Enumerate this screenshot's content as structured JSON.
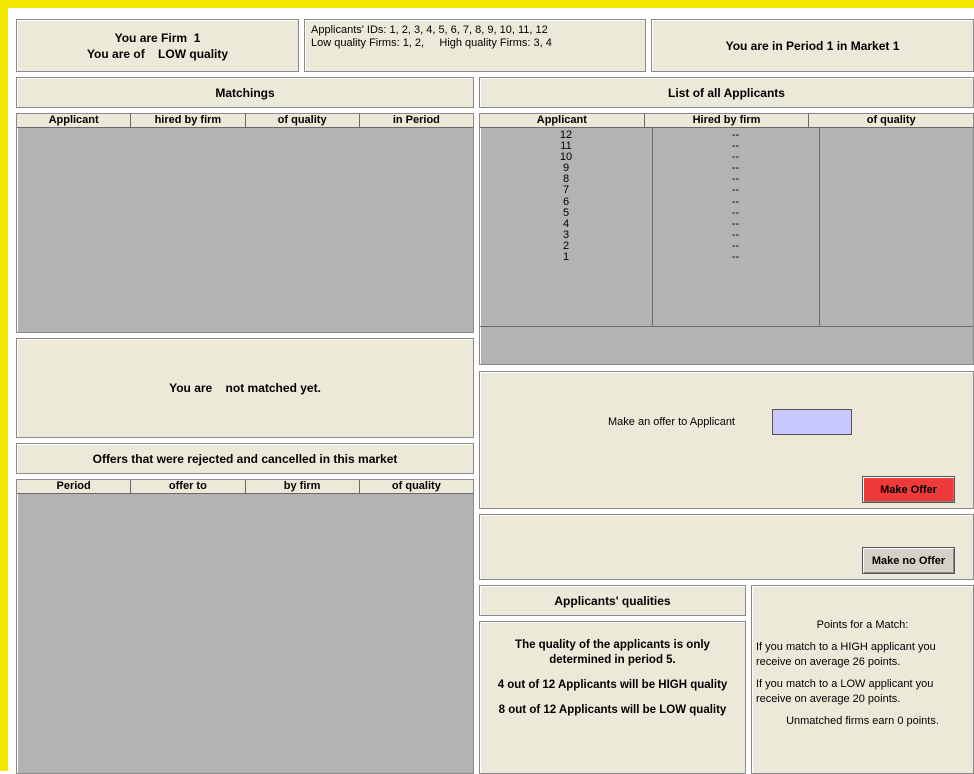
{
  "header": {
    "firm_line": "You are Firm  1",
    "quality_line": "You are of    LOW quality",
    "ids_line": "Applicants' IDs: 1, 2, 3, 4, 5, 6, 7, 8, 9, 10, 11, 12",
    "firms_line": "Low quality Firms: 1, 2,     High quality Firms: 3, 4",
    "period_line": "You are in Period 1 in Market 1"
  },
  "matchings": {
    "title": "Matchings",
    "columns": [
      "Applicant",
      "hired by firm",
      "of quality",
      "in Period"
    ]
  },
  "match_status": "You are    not matched yet.",
  "offers": {
    "title": "Offers that were rejected and cancelled in this market",
    "columns": [
      "Period",
      "offer to",
      "by firm",
      "of quality"
    ]
  },
  "applicants": {
    "title": "List of all Applicants",
    "columns": [
      "Applicant",
      "Hired by firm",
      "of quality"
    ],
    "rows": [
      {
        "id": "12",
        "hired": "--"
      },
      {
        "id": "11",
        "hired": "--"
      },
      {
        "id": "10",
        "hired": "--"
      },
      {
        "id": "9",
        "hired": "--"
      },
      {
        "id": "8",
        "hired": "--"
      },
      {
        "id": "7",
        "hired": "--"
      },
      {
        "id": "6",
        "hired": "--"
      },
      {
        "id": "5",
        "hired": "--"
      },
      {
        "id": "4",
        "hired": "--"
      },
      {
        "id": "3",
        "hired": "--"
      },
      {
        "id": "2",
        "hired": "--"
      },
      {
        "id": "1",
        "hired": "--"
      }
    ]
  },
  "offer_form": {
    "label": "Make an offer to Applicant",
    "input_value": "",
    "make_offer_label": "Make Offer",
    "make_no_offer_label": "Make no Offer"
  },
  "qualities": {
    "title": "Applicants' qualities",
    "line1": "The quality of the applicants is only determined in period 5.",
    "line2": "4 out of 12 Applicants will be HIGH quality",
    "line3": "8 out of 12 Applicants will be LOW quality"
  },
  "points": {
    "title": "Points for a Match:",
    "high": "If you match to a HIGH applicant you receive on average 26 points.",
    "low": "If you match to a LOW applicant you receive on average 20 points.",
    "unmatched": "Unmatched firms earn 0 points."
  },
  "colors": {
    "border_yellow": "#f4e600",
    "panel": "#ece9d8",
    "table_gray": "#b3b3b3",
    "offer_red": "#ee3a3a",
    "input_lavender": "#c8c8ff"
  }
}
